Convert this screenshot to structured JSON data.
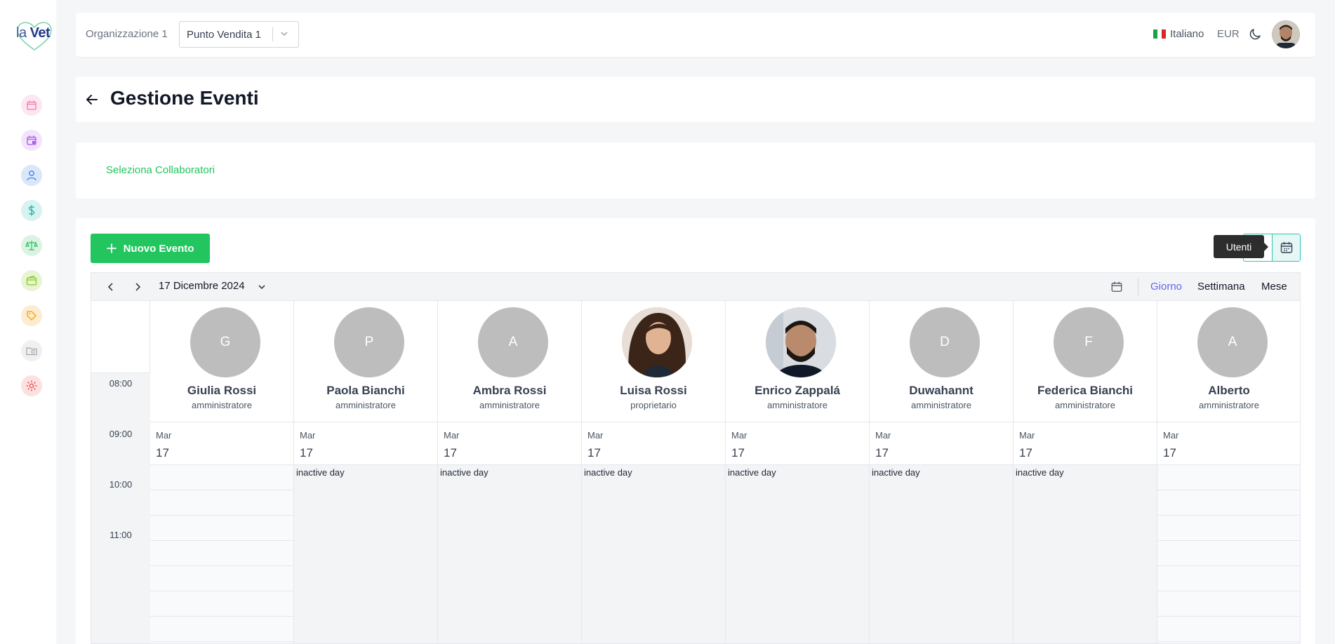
{
  "logo": {
    "part1": "la",
    "part2": "Vet"
  },
  "topbar": {
    "org_label": "Organizzazione 1",
    "store_value": "Punto Vendita 1",
    "language": "Italiano",
    "currency": "EUR"
  },
  "sidebar_icons": [
    {
      "name": "calendar-icon",
      "color": "#f472b6",
      "bg": "#fde7ef"
    },
    {
      "name": "calendar-check-icon",
      "color": "#a855f7",
      "bg": "#f1e4fb"
    },
    {
      "name": "user-icon",
      "color": "#3b82f6",
      "bg": "#dbe6f7"
    },
    {
      "name": "dollar-icon",
      "color": "#14b8a6",
      "bg": "#d7f2ef"
    },
    {
      "name": "scale-icon",
      "color": "#22c55e",
      "bg": "#dcf3e3"
    },
    {
      "name": "wallet-icon",
      "color": "#84cc16",
      "bg": "#e8f5d4"
    },
    {
      "name": "tag-icon",
      "color": "#f59e0b",
      "bg": "#fdeccf"
    },
    {
      "name": "folder-search-icon",
      "color": "#9ca3af",
      "bg": "#f0f0f0"
    },
    {
      "name": "gear-icon",
      "color": "#ef4444",
      "bg": "#fde0e0"
    }
  ],
  "page": {
    "title": "Gestione Eventi"
  },
  "collaborators": {
    "link": "Seleziona Collaboratori"
  },
  "calendar": {
    "new_event": "Nuovo Evento",
    "tooltip": "Utenti",
    "current_date": "17 Dicembre 2024",
    "views": {
      "day": "Giorno",
      "week": "Settimana",
      "month": "Mese"
    },
    "times": [
      "08:00",
      "09:00",
      "10:00",
      "11:00"
    ],
    "inactive_label": "inactive day",
    "columns": [
      {
        "initial": "G",
        "name": "Giulia Rossi",
        "role": "amministratore",
        "dow": "Mar",
        "day": "17",
        "active": true,
        "photo": false
      },
      {
        "initial": "P",
        "name": "Paola Bianchi",
        "role": "amministratore",
        "dow": "Mar",
        "day": "17",
        "active": false,
        "photo": false
      },
      {
        "initial": "A",
        "name": "Ambra Rossi",
        "role": "amministratore",
        "dow": "Mar",
        "day": "17",
        "active": false,
        "photo": false
      },
      {
        "initial": "",
        "name": "Luisa Rossi",
        "role": "proprietario",
        "dow": "Mar",
        "day": "17",
        "active": false,
        "photo": true
      },
      {
        "initial": "",
        "name": "Enrico Zappalá",
        "role": "amministratore",
        "dow": "Mar",
        "day": "17",
        "active": false,
        "photo": true
      },
      {
        "initial": "D",
        "name": "Duwahannt",
        "role": "amministratore",
        "dow": "Mar",
        "day": "17",
        "active": false,
        "photo": false
      },
      {
        "initial": "F",
        "name": "Federica Bianchi",
        "role": "amministratore",
        "dow": "Mar",
        "day": "17",
        "active": false,
        "photo": false
      },
      {
        "initial": "A",
        "name": "Alberto",
        "role": "amministratore",
        "dow": "Mar",
        "day": "17",
        "active": true,
        "photo": false
      }
    ]
  }
}
